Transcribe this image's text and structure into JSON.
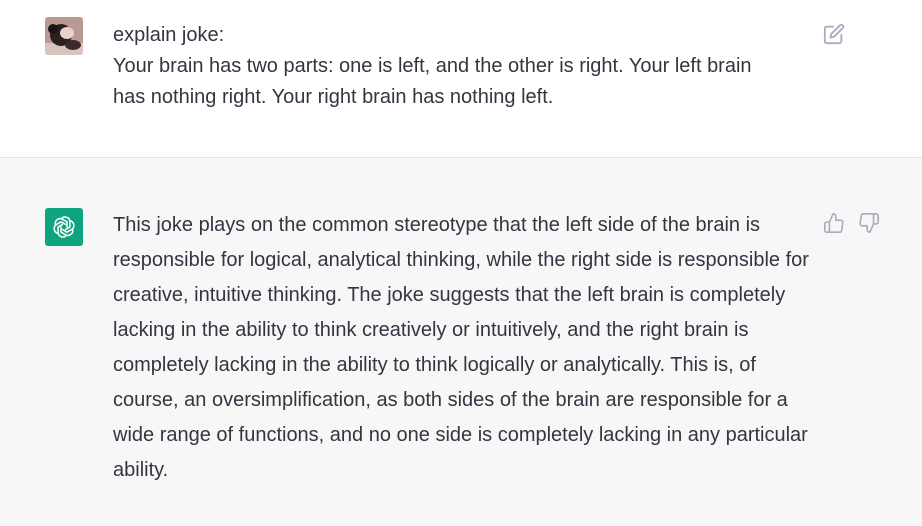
{
  "user_message": {
    "avatar_icon": "user-avatar-photo",
    "line1": "explain joke:",
    "line2": "Your brain has two parts: one is left, and the other is right. Your left brain has nothing right. Your right brain has nothing left.",
    "edit_icon": "edit-icon"
  },
  "assistant_message": {
    "avatar_icon": "openai-logo-icon",
    "avatar_color": "#10a37f",
    "text": "This joke plays on the common stereotype that the left side of the brain is responsible for logical, analytical thinking, while the right side is responsible for creative, intuitive thinking. The joke suggests that the left brain is completely lacking in the ability to think creatively or intuitively, and the right brain is completely lacking in the ability to think logically or analytically. This is, of course, an oversimplification, as both sides of the brain are responsible for a wide range of functions, and no one side is completely lacking in any particular ability.",
    "thumbs_up_icon": "thumbs-up-icon",
    "thumbs_down_icon": "thumbs-down-icon"
  },
  "colors": {
    "user_bg": "#ffffff",
    "assistant_bg": "#f7f7f8",
    "text": "#343541",
    "icon": "#acacbe"
  }
}
